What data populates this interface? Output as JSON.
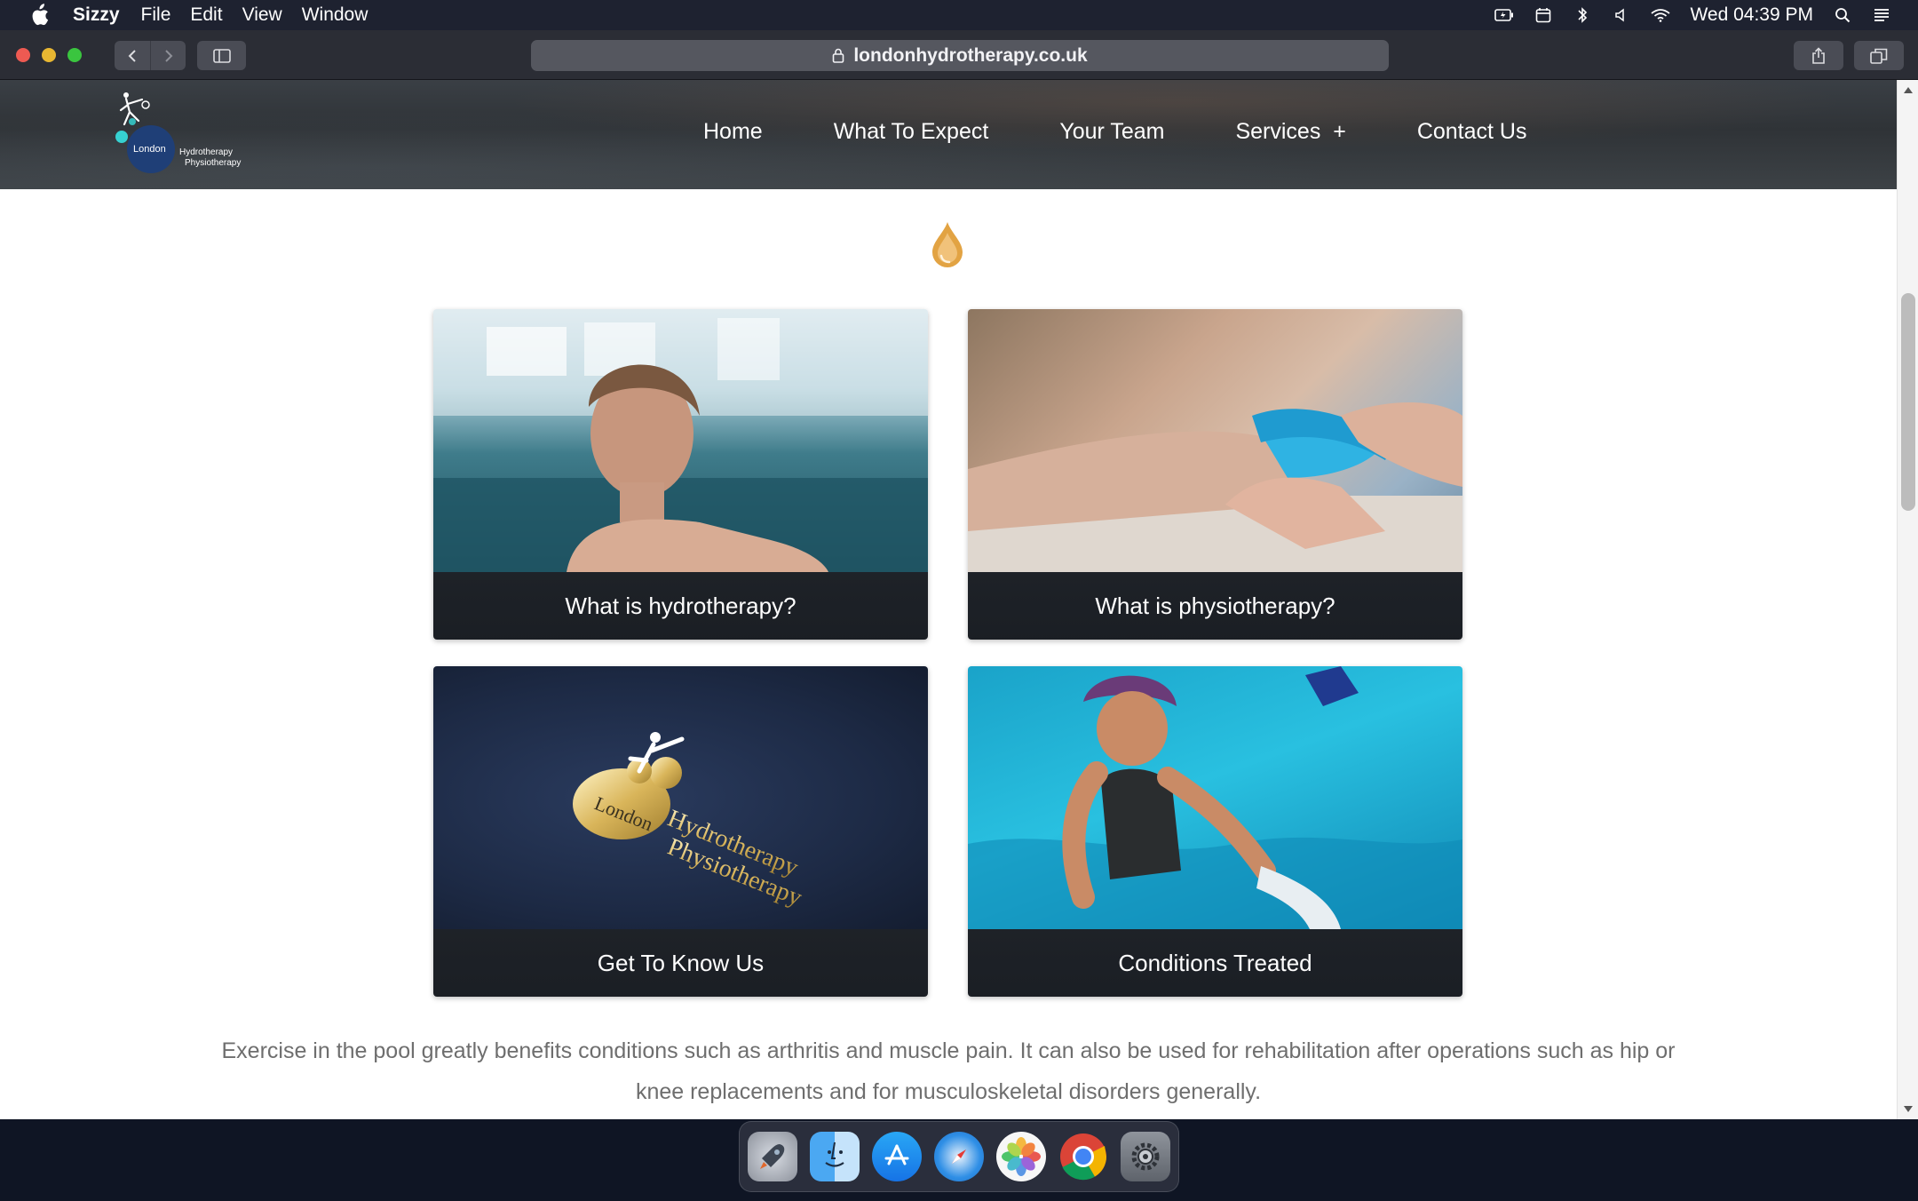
{
  "menubar": {
    "app_name": "Sizzy",
    "menus": [
      "File",
      "Edit",
      "View",
      "Window"
    ],
    "clock": "Wed 04:39 PM",
    "status_icons": [
      "battery-icon",
      "calendar-icon",
      "bluetooth-icon",
      "volume-icon",
      "wifi-icon",
      "spotlight-search-icon",
      "notification-center-icon"
    ]
  },
  "browser": {
    "url": "londonhydrotherapy.co.uk"
  },
  "site": {
    "logo": {
      "word_london": "London",
      "word_hydrotherapy": "Hydrotherapy",
      "word_physiotherapy": "Physiotherapy"
    },
    "nav": [
      "Home",
      "What To Expect",
      "Your Team",
      "Services  +",
      "Contact Us"
    ]
  },
  "cards": [
    {
      "caption": "What is hydrotherapy?",
      "image": "woman resting at pool edge"
    },
    {
      "caption": "What is physiotherapy?",
      "image": "therapist stretching ankle"
    },
    {
      "caption": "Get To Know Us",
      "image": "gold foil logo on navy card"
    },
    {
      "caption": "Conditions Treated",
      "image": "swimmer in pool with float"
    }
  ],
  "card_logo": {
    "london": "London",
    "hydrotherapy": "Hydrotherapy",
    "physiotherapy": "Physiotherapy"
  },
  "body_text": "Exercise in the pool greatly benefits conditions such as arthritis and muscle pain.  It can also be used for rehabilitation after operations such as hip or knee replacements and for musculoskeletal disorders generally.",
  "dock": [
    "launchpad-icon",
    "finder-icon",
    "app-store-icon",
    "safari-icon",
    "photos-icon",
    "chrome-icon",
    "system-preferences-icon"
  ],
  "colors": {
    "accent_drop": "#e0a040",
    "header_bg": "#33383c",
    "text_gray": "#6e6e6e"
  }
}
